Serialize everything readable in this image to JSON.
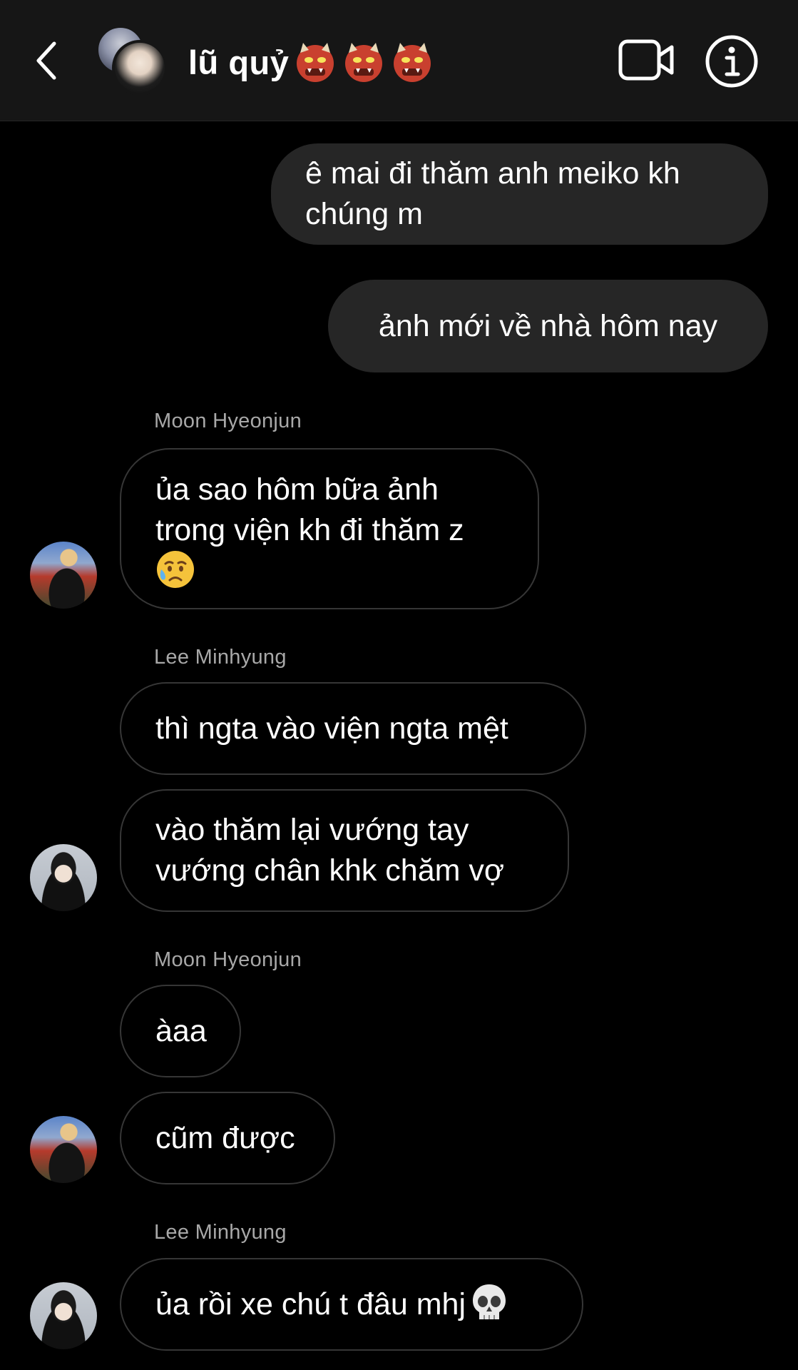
{
  "header": {
    "title": "lũ quỷ",
    "title_emojis": [
      "ogre-icon",
      "ogre-icon",
      "ogre-icon"
    ],
    "icons": {
      "back": "chevron-left-icon",
      "video": "video-camera-icon",
      "info": "info-icon"
    }
  },
  "messages": [
    {
      "id": "m1",
      "direction": "outgoing",
      "text": "ê mai đi thăm anh meiko kh chúng m"
    },
    {
      "id": "m2",
      "direction": "outgoing",
      "text": "ảnh mới về nhà hôm nay"
    },
    {
      "id": "m3",
      "direction": "incoming",
      "sender": "Moon Hyeonjun",
      "text": "ủa sao hôm bữa ảnh trong viện kh đi thăm z",
      "emoji": "sad-but-relieved-face-icon"
    },
    {
      "id": "m4",
      "direction": "incoming",
      "sender": "Lee Minhyung",
      "text": "thì ngta vào viện ngta mệt"
    },
    {
      "id": "m5",
      "direction": "incoming",
      "sender": "Lee Minhyung",
      "text": "vào thăm lại vướng tay vướng chân khk chăm vợ"
    },
    {
      "id": "m6",
      "direction": "incoming",
      "sender": "Moon Hyeonjun",
      "text": "àaa"
    },
    {
      "id": "m7",
      "direction": "incoming",
      "sender": "Moon Hyeonjun",
      "text": "cũm được"
    },
    {
      "id": "m8",
      "direction": "incoming",
      "sender": "Lee Minhyung",
      "text": "ủa rồi xe chú t đâu mhj",
      "emoji": "skull-icon"
    }
  ],
  "sender_labels": {
    "group1": "Moon Hyeonjun",
    "group2": "Lee Minhyung",
    "group3": "Moon Hyeonjun",
    "group4": "Lee Minhyung"
  },
  "colors": {
    "background": "#000000",
    "header_bg": "#161616",
    "outgoing_bubble": "#262626",
    "incoming_border": "#363636",
    "sender_label": "#a8a8a8"
  }
}
